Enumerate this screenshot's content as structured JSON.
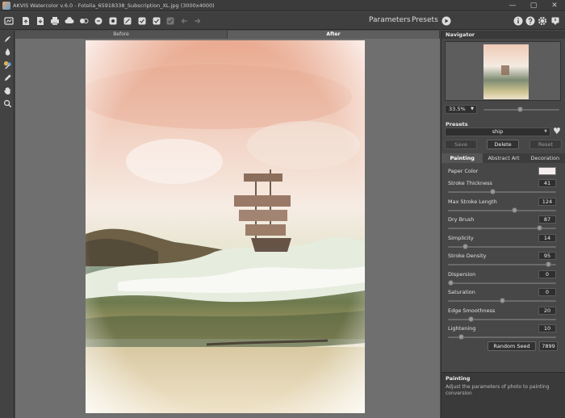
{
  "window": {
    "title": "AKVIS Watercolor v.6.0 - Fotolia_65918338_Subscription_XL.jpg (3000x4000)",
    "minimize_glyph": "—",
    "maximize_glyph": "▢",
    "close_glyph": "✕"
  },
  "toolbar": {
    "parameters_label": "Parameters",
    "presets_label": "Presets",
    "icons": [
      "home-icon",
      "open-file-icon",
      "save-file-icon",
      "print-icon",
      "cloud-share-icon",
      "batch-icon",
      "batch2-icon",
      "batch3-icon",
      "batch4-icon",
      "run-check-icon",
      "apply-icon",
      "apply-disabled-icon",
      "undo-icon",
      "redo-icon"
    ]
  },
  "view_tabs": {
    "before": "Before",
    "after": "After"
  },
  "navigator": {
    "title": "Navigator",
    "zoom_value": "33.5%",
    "zoom_slider_level": 0.48
  },
  "presets": {
    "label": "Presets",
    "selected": "ship",
    "save_label": "Save",
    "delete_label": "Delete",
    "reset_label": "Reset"
  },
  "param_tabs": {
    "painting": "Painting",
    "abstract": "Abstract Art",
    "decoration": "Decoration"
  },
  "params": {
    "paper_color_label": "Paper Color",
    "paper_color": "#f6eeee",
    "items": [
      {
        "label": "Stroke Thickness",
        "value": "41",
        "level": 0.41
      },
      {
        "label": "Max Stroke Length",
        "value": "124",
        "level": 0.62
      },
      {
        "label": "Dry Brush",
        "value": "87",
        "level": 0.87
      },
      {
        "label": "Simplicity",
        "value": "14",
        "level": 0.14
      },
      {
        "label": "Stroke Density",
        "value": "95",
        "level": 0.95
      },
      {
        "label": "Dispersion",
        "value": "0",
        "level": 0.0
      },
      {
        "label": "Saturation",
        "value": "0",
        "level": 0.5
      },
      {
        "label": "Edge Smoothness",
        "value": "20",
        "level": 0.2
      },
      {
        "label": "Lightening",
        "value": "10",
        "level": 0.1
      }
    ],
    "random_seed_label": "Random Seed",
    "random_seed_value": "7899"
  },
  "help": {
    "title": "Painting",
    "text": "Adjust the parameters of photo to painting conversion"
  },
  "colors": {
    "accent": "#e0e0e0",
    "background": "#4a4a4a"
  }
}
